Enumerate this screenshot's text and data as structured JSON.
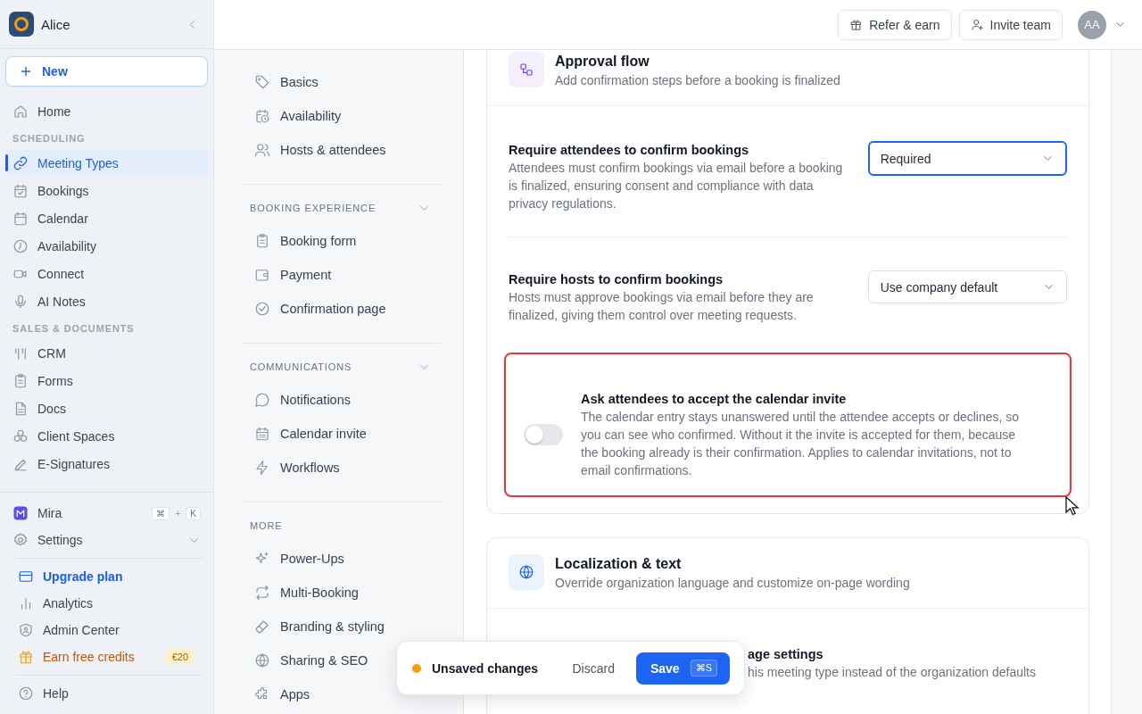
{
  "sidebar": {
    "workspace": "Alice",
    "new_button": "New",
    "nav": [
      {
        "kind": "item",
        "label": "Home",
        "selected": false
      },
      {
        "kind": "heading",
        "label": "SCHEDULING"
      },
      {
        "kind": "item",
        "label": "Meeting Types",
        "selected": true
      },
      {
        "kind": "item",
        "label": "Bookings",
        "selected": false
      },
      {
        "kind": "item",
        "label": "Calendar",
        "selected": false
      },
      {
        "kind": "item",
        "label": "Availability",
        "selected": false
      },
      {
        "kind": "item",
        "label": "Connect",
        "selected": false
      },
      {
        "kind": "item",
        "label": "AI Notes",
        "selected": false
      },
      {
        "kind": "heading",
        "label": "SALES & DOCUMENTS"
      },
      {
        "kind": "item",
        "label": "CRM",
        "selected": false
      },
      {
        "kind": "item",
        "label": "Forms",
        "selected": false
      },
      {
        "kind": "item",
        "label": "Docs",
        "selected": false
      },
      {
        "kind": "item",
        "label": "Client Spaces",
        "selected": false
      },
      {
        "kind": "item",
        "label": "E-Signatures",
        "selected": false
      }
    ],
    "bottom_groups": [
      [
        {
          "kind": "assistant",
          "label": "Mira",
          "keys": [
            "⌘",
            "K"
          ],
          "key_joiner": "+"
        },
        {
          "kind": "expandable",
          "label": "Settings",
          "expanded": false
        }
      ],
      [
        {
          "kind": "accent",
          "label": "Upgrade plan"
        },
        {
          "kind": "plain",
          "label": "Analytics"
        },
        {
          "kind": "plain",
          "label": "Admin Center"
        },
        {
          "kind": "promo",
          "label": "Earn free credits",
          "badge": "€20"
        }
      ],
      [
        {
          "kind": "plain",
          "label": "Help"
        }
      ]
    ]
  },
  "topbar": {
    "buttons": [
      "Refer & earn",
      "Invite team"
    ],
    "avatar": "AA"
  },
  "settings_nav": {
    "groups": [
      {
        "items": [
          {
            "label": "Basics",
            "selected": false
          },
          {
            "label": "Availability",
            "selected": false
          },
          {
            "label": "Hosts & attendees",
            "selected": false
          }
        ]
      },
      {
        "heading": "BOOKING EXPERIENCE",
        "expanded": true,
        "items": [
          {
            "label": "Booking form",
            "selected": false
          },
          {
            "label": "Payment",
            "selected": false
          },
          {
            "label": "Confirmation page",
            "selected": false
          }
        ]
      },
      {
        "heading": "COMMUNICATIONS",
        "expanded": true,
        "items": [
          {
            "label": "Notifications",
            "selected": false
          },
          {
            "label": "Calendar invite",
            "selected": false
          },
          {
            "label": "Workflows",
            "selected": false
          }
        ]
      },
      {
        "heading": "MORE",
        "items": [
          {
            "label": "Power-Ups",
            "selected": false
          },
          {
            "label": "Multi-Booking",
            "selected": false
          },
          {
            "label": "Branding & styling",
            "selected": false
          },
          {
            "label": "Sharing & SEO",
            "selected": false
          },
          {
            "label": "Apps",
            "selected": false
          }
        ]
      }
    ]
  },
  "sections": [
    {
      "title": "Approval flow",
      "subtitle": "Add confirmation steps before a booking is finalized",
      "rows": [
        {
          "kind": "select",
          "label": "Require attendees to confirm bookings",
          "description": "Attendees must confirm bookings via email before a booking is finalized, ensuring consent and compliance with data privacy regulations.",
          "value": "Required",
          "focused": true
        },
        {
          "kind": "select",
          "label": "Require hosts to confirm bookings",
          "description": "Hosts must approve bookings via email before they are finalized, giving them control over meeting requests.",
          "value": "Use company default",
          "focused": false
        },
        {
          "kind": "toggle",
          "label": "Ask attendees to accept the calendar invite",
          "description": "The calendar entry stays unanswered until the attendee accepts or declines, so you can see who confirmed. Without it the invite is accepted for them, because the booking already is their confirmation. Applies to calendar invitations, not to email confirmations.",
          "on": false,
          "highlighted": true
        }
      ]
    },
    {
      "title": "Localization & text",
      "subtitle": "Override organization language and customize on-page wording",
      "rows": [
        {
          "kind": "partial",
          "label": "age settings",
          "description": "his meeting type instead of the organization defaults"
        }
      ]
    }
  ],
  "toast": {
    "status": "Unsaved changes",
    "discard": "Discard",
    "save": "Save",
    "shortcut": "⌘S"
  }
}
